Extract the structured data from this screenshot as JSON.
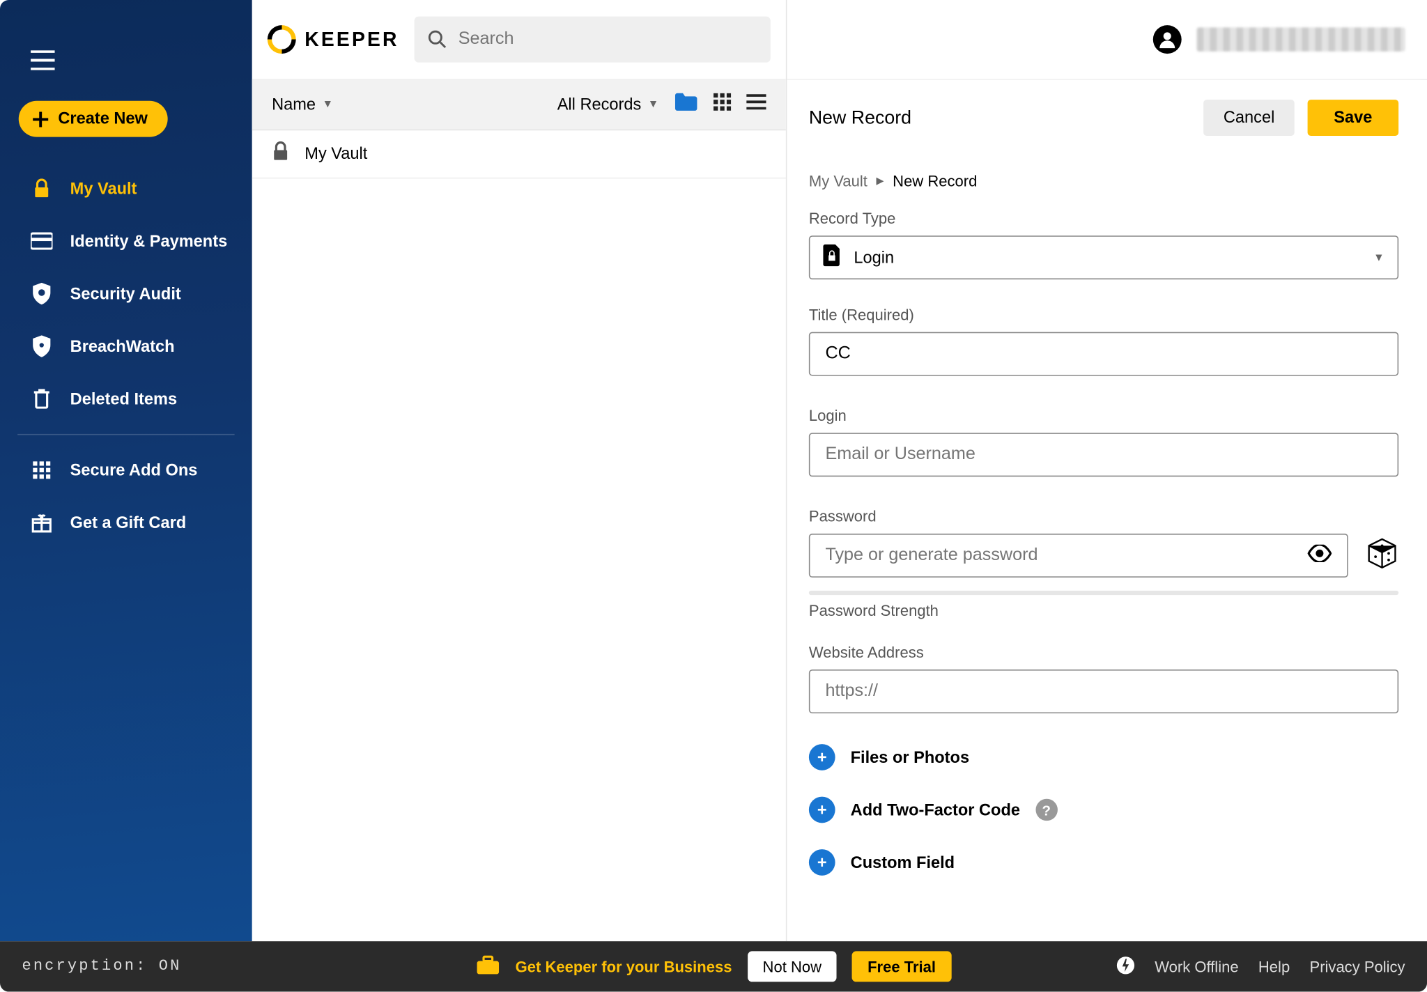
{
  "window": {
    "app": "KEEPER"
  },
  "sidebar": {
    "create_label": "Create New",
    "items": [
      {
        "label": "My Vault"
      },
      {
        "label": "Identity & Payments"
      },
      {
        "label": "Security Audit"
      },
      {
        "label": "BreachWatch"
      },
      {
        "label": "Deleted Items"
      },
      {
        "label": "Secure Add Ons"
      },
      {
        "label": "Get a Gift Card"
      }
    ]
  },
  "search": {
    "placeholder": "Search"
  },
  "list": {
    "sort_by": "Name",
    "filter": "All Records",
    "rows": [
      {
        "label": "My Vault"
      }
    ]
  },
  "detail": {
    "header_title": "New Record",
    "cancel": "Cancel",
    "save": "Save",
    "breadcrumb_root": "My Vault",
    "breadcrumb_leaf": "New Record",
    "record_type_label": "Record Type",
    "record_type_value": "Login",
    "title_label": "Title (Required)",
    "title_value": "CC",
    "login_label": "Login",
    "login_placeholder": "Email or Username",
    "password_label": "Password",
    "password_placeholder": "Type or generate password",
    "password_strength_label": "Password Strength",
    "website_label": "Website Address",
    "website_placeholder": "https://",
    "add_files": "Files or Photos",
    "add_2fa": "Add Two-Factor Code",
    "add_custom": "Custom Field"
  },
  "footer": {
    "encryption": "encryption: ON",
    "business": "Get Keeper for your Business",
    "not_now": "Not Now",
    "free_trial": "Free Trial",
    "work_offline": "Work Offline",
    "help": "Help",
    "privacy": "Privacy Policy"
  }
}
